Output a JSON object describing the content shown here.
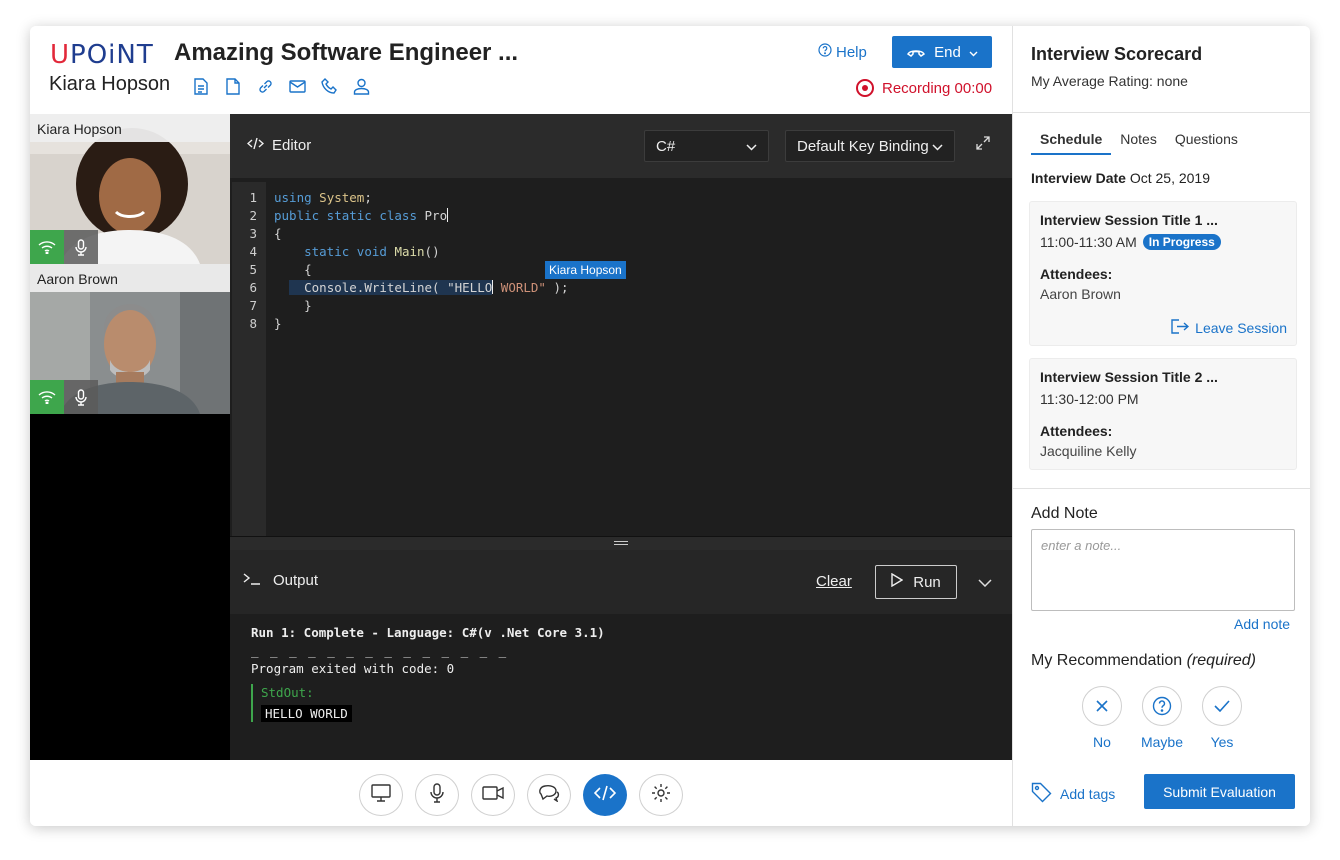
{
  "header": {
    "logo": "UPOINT",
    "job_title": "Amazing Software Engineer ...",
    "candidate_name": "Kiara Hopson",
    "help_label": "Help",
    "end_label": "End",
    "recording_label": "Recording 00:00"
  },
  "videos": [
    {
      "name": "Kiara Hopson"
    },
    {
      "name": "Aaron Brown"
    }
  ],
  "editor": {
    "title": "Editor",
    "language": "C#",
    "keybinding": "Default Key Binding",
    "collaborator_label": "Kiara Hopson",
    "line_numbers": [
      "1",
      "2",
      "3",
      "4",
      "5",
      "6",
      "7",
      "8"
    ]
  },
  "output": {
    "title": "Output",
    "clear_label": "Clear",
    "run_label": "Run",
    "run_summary": "Run 1: Complete - Language: C#(v .Net Core 3.1)",
    "dashes": "_ _ _ _ _ _ _ _ _ _ _ _ _ _",
    "exit_line": "Program exited with code: 0",
    "stdout_label": "StdOut:",
    "stdout_value": "HELLO WORLD"
  },
  "scorecard": {
    "title": "Interview Scorecard",
    "avg_rating": "My Average Rating: none",
    "tabs": [
      "Schedule",
      "Notes",
      "Questions"
    ],
    "interview_date_label": "Interview Date",
    "interview_date": "Oct 25, 2019",
    "sessions": [
      {
        "title": "Interview Session Title 1 ...",
        "time": "11:00-11:30 AM",
        "badge": "In Progress",
        "attendees_label": "Attendees:",
        "attendee": "Aaron Brown",
        "leave_label": "Leave Session"
      },
      {
        "title": "Interview Session Title 2 ...",
        "time": "11:30-12:00 PM",
        "attendees_label": "Attendees:",
        "attendee": "Jacquiline Kelly"
      }
    ],
    "add_note_title": "Add Note",
    "note_placeholder": "enter a note...",
    "add_note_link": "Add note",
    "recommendation_title": "My Recommendation",
    "recommendation_required": "(required)",
    "choices": [
      "No",
      "Maybe",
      "Yes"
    ],
    "add_tags": "Add tags",
    "submit": "Submit Evaluation"
  },
  "colors": {
    "accent": "#1a73c9",
    "record": "#d0112b",
    "online": "#3ea64c",
    "editor_bg": "#1e1e1e"
  }
}
